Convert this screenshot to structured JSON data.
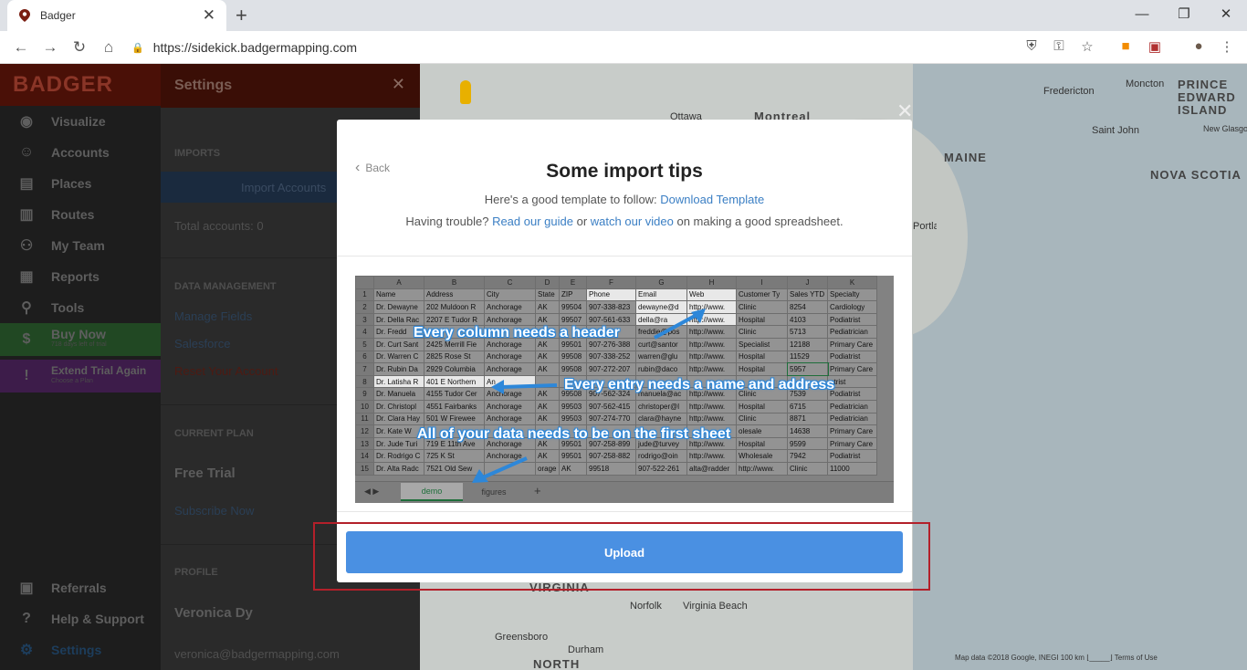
{
  "browser": {
    "tab_title": "Badger",
    "url": "https://sidekick.badgermapping.com"
  },
  "colors": {
    "accent_blue": "#4a90e2",
    "link_blue": "#3b7fc4",
    "highlight_red": "#b3202a",
    "logo_red": "#4a1007"
  },
  "sidebar": {
    "logo": "BADGER",
    "items": [
      {
        "label": "Visualize",
        "icon": "eye-icon"
      },
      {
        "label": "Accounts",
        "icon": "person-icon"
      },
      {
        "label": "Places",
        "icon": "store-icon"
      },
      {
        "label": "Routes",
        "icon": "map-icon"
      },
      {
        "label": "My Team",
        "icon": "team-icon"
      },
      {
        "label": "Reports",
        "icon": "report-icon"
      },
      {
        "label": "Tools",
        "icon": "tools-icon"
      }
    ],
    "buy_now": {
      "label": "Buy Now",
      "sub": "718 days left of trial"
    },
    "extend": {
      "label": "Extend Trial Again",
      "sub": "Choose a Plan"
    },
    "bottom": [
      {
        "label": "Referrals",
        "icon": "gift-icon"
      },
      {
        "label": "Help & Support",
        "icon": "help-icon"
      },
      {
        "label": "Settings",
        "icon": "gear-icon"
      }
    ]
  },
  "settings": {
    "title": "Settings",
    "imports_header": "IMPORTS",
    "import_button": "Import Accounts",
    "total_accounts": "Total accounts: 0",
    "data_header": "DATA MANAGEMENT",
    "manage_fields": "Manage Fields",
    "salesforce": "Salesforce",
    "reset": "Reset Your Account",
    "plan_header": "CURRENT PLAN",
    "plan": "Free Trial",
    "subscribe": "Subscribe Now",
    "profile_header": "PROFILE",
    "name": "Veronica Dy",
    "email": "veronica@badgermapping.com"
  },
  "map": {
    "labels": [
      "Fredericton",
      "Moncton",
      "PRINCE EDWARD ISLAND",
      "Saint John",
      "New Glasgow",
      "MAINE",
      "NOVA SCOTIA",
      "Ottawa",
      "Montreal",
      "Portland",
      "VIRGINIA",
      "Norfolk",
      "Virginia Beach",
      "Greensboro",
      "Durham",
      "NORTH"
    ],
    "footer": "Map data ©2018 Google, INEGI   100 km ⌊_____⌋   Terms of Use"
  },
  "modal": {
    "back": "Back",
    "title": "Some import tips",
    "line1_pre": "Here's a good template to follow:",
    "line1_link": "Download Template",
    "line2_pre": "Having trouble?",
    "line2_link1": "Read our guide",
    "line2_mid": "or",
    "line2_link2": "watch our video",
    "line2_post": "on making a good spreadsheet.",
    "upload": "Upload"
  },
  "sheet": {
    "col_letters": [
      "",
      "A",
      "B",
      "C",
      "D",
      "E",
      "F",
      "G",
      "H",
      "I",
      "J",
      "K"
    ],
    "rows": [
      [
        "1",
        "Name",
        "Address",
        "City",
        "State",
        "ZIP",
        "Phone",
        "Email",
        "Web",
        "Customer Ty",
        "Sales YTD",
        "Specialty"
      ],
      [
        "2",
        "Dr. Dewayne",
        "202 Muldoon R",
        "Anchorage",
        "AK",
        "99504",
        "907-338-823",
        "dewayne@d",
        "http://www.",
        "Clinic",
        "8254",
        "Cardiology"
      ],
      [
        "3",
        "Dr. Della Rac",
        "2207 E Tudor R",
        "Anchorage",
        "AK",
        "99507",
        "907-561-633",
        "della@ra",
        "http://www.",
        "Hospital",
        "4103",
        "Podiatrist"
      ],
      [
        "4",
        "Dr. Fredd",
        "",
        "",
        "",
        "",
        "",
        "freddie@pos",
        "http://www.",
        "Clinic",
        "5713",
        "Pediatrician"
      ],
      [
        "5",
        "Dr. Curt Sant",
        "2425 Merrill Fie",
        "Anchorage",
        "AK",
        "99501",
        "907-276-388",
        "curt@santor",
        "http://www.",
        "Specialist",
        "12188",
        "Primary Care"
      ],
      [
        "6",
        "Dr. Warren C",
        "2825 Rose St",
        "Anchorage",
        "AK",
        "99508",
        "907-338-252",
        "warren@glu",
        "http://www.",
        "Hospital",
        "11529",
        "Podiatrist"
      ],
      [
        "7",
        "Dr. Rubin Da",
        "2929 Columbia",
        "Anchorage",
        "AK",
        "99508",
        "907-272-207",
        "rubin@daco",
        "http://www.",
        "Hospital",
        "5957",
        "Primary Care"
      ],
      [
        "8",
        "Dr. Latisha R",
        "401 E Northern",
        "An",
        "",
        "",
        "",
        "",
        "",
        "",
        "",
        "atrist"
      ],
      [
        "9",
        "Dr. Manuela",
        "4155 Tudor Cer",
        "Anchorage",
        "AK",
        "99508",
        "907-562-324",
        "manuela@ac",
        "http://www.",
        "Clinic",
        "7539",
        "Podiatrist"
      ],
      [
        "10",
        "Dr. Christopl",
        "4551 Fairbanks",
        "Anchorage",
        "AK",
        "99503",
        "907-562-415",
        "christoper@l",
        "http://www.",
        "Hospital",
        "6715",
        "Pediatrician"
      ],
      [
        "11",
        "Dr. Clara Hay",
        "501 W Firewee",
        "Anchorage",
        "AK",
        "99503",
        "907-274-770",
        "clara@hayne",
        "http://www.",
        "Clinic",
        "8871",
        "Pediatrician"
      ],
      [
        "12",
        "Dr. Kate W",
        "",
        "",
        "",
        "",
        "",
        "",
        "",
        "olesale",
        "14638",
        "Primary Care"
      ],
      [
        "13",
        "Dr. Jude Turi",
        "719 E 11th Ave",
        "Anchorage",
        "AK",
        "99501",
        "907-258-899",
        "jude@turvey",
        "http://www.",
        "Hospital",
        "9599",
        "Primary Care"
      ],
      [
        "14",
        "Dr. Rodrigo C",
        "725 K St",
        "Anchorage",
        "AK",
        "99501",
        "907-258-882",
        "rodrigo@oin",
        "http://www.",
        "Wholesale",
        "7942",
        "Podiatrist"
      ],
      [
        "15",
        "Dr. Alta Radc",
        "7521 Old Sew",
        "",
        "orage",
        "AK",
        "99518",
        "907-522-261",
        "alta@radder",
        "http://www.",
        "Clinic",
        "11000"
      ]
    ],
    "tabs": [
      "demo",
      "figures"
    ],
    "annotations": {
      "header": "Every column needs a header",
      "entry": "Every entry needs a name and address",
      "sheet": "All of your data needs to be on the first sheet"
    }
  }
}
